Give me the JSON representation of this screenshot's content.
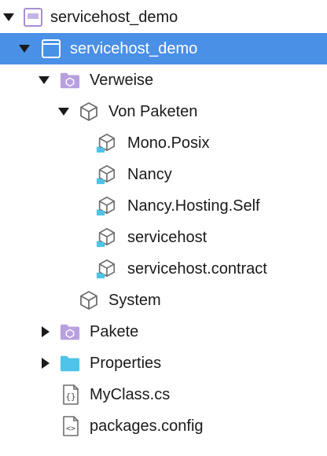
{
  "tree": {
    "items": [
      {
        "label": "servicehost_demo",
        "kind": "solution",
        "expanded": true,
        "selected": false,
        "depth": 0
      },
      {
        "label": "servicehost_demo",
        "kind": "project",
        "expanded": true,
        "selected": true,
        "depth": 1
      },
      {
        "label": "Verweise",
        "kind": "folder-references",
        "expanded": true,
        "selected": false,
        "depth": 2
      },
      {
        "label": "Von Paketen",
        "kind": "package-group",
        "expanded": true,
        "selected": false,
        "depth": 3
      },
      {
        "label": "Mono.Posix",
        "kind": "package-reference",
        "selected": false,
        "depth": 4
      },
      {
        "label": "Nancy",
        "kind": "package-reference",
        "selected": false,
        "depth": 4
      },
      {
        "label": "Nancy.Hosting.Self",
        "kind": "package-reference",
        "selected": false,
        "depth": 4
      },
      {
        "label": "servicehost",
        "kind": "package-reference",
        "selected": false,
        "depth": 4
      },
      {
        "label": "servicehost.contract",
        "kind": "package-reference",
        "selected": false,
        "depth": 4
      },
      {
        "label": "System",
        "kind": "assembly-reference",
        "selected": false,
        "depth": 3
      },
      {
        "label": "Pakete",
        "kind": "folder-packages",
        "expanded": false,
        "selected": false,
        "depth": 2
      },
      {
        "label": "Properties",
        "kind": "folder",
        "expanded": false,
        "selected": false,
        "depth": 2
      },
      {
        "label": "MyClass.cs",
        "kind": "csharp-file",
        "selected": false,
        "depth": 2
      },
      {
        "label": "packages.config",
        "kind": "config-file",
        "selected": false,
        "depth": 2
      }
    ]
  },
  "colors": {
    "selection": "#4a90e6",
    "folder_purple": "#b8a0de",
    "folder_blue": "#4fc3e8",
    "icon_gray": "#6e6e6e"
  }
}
